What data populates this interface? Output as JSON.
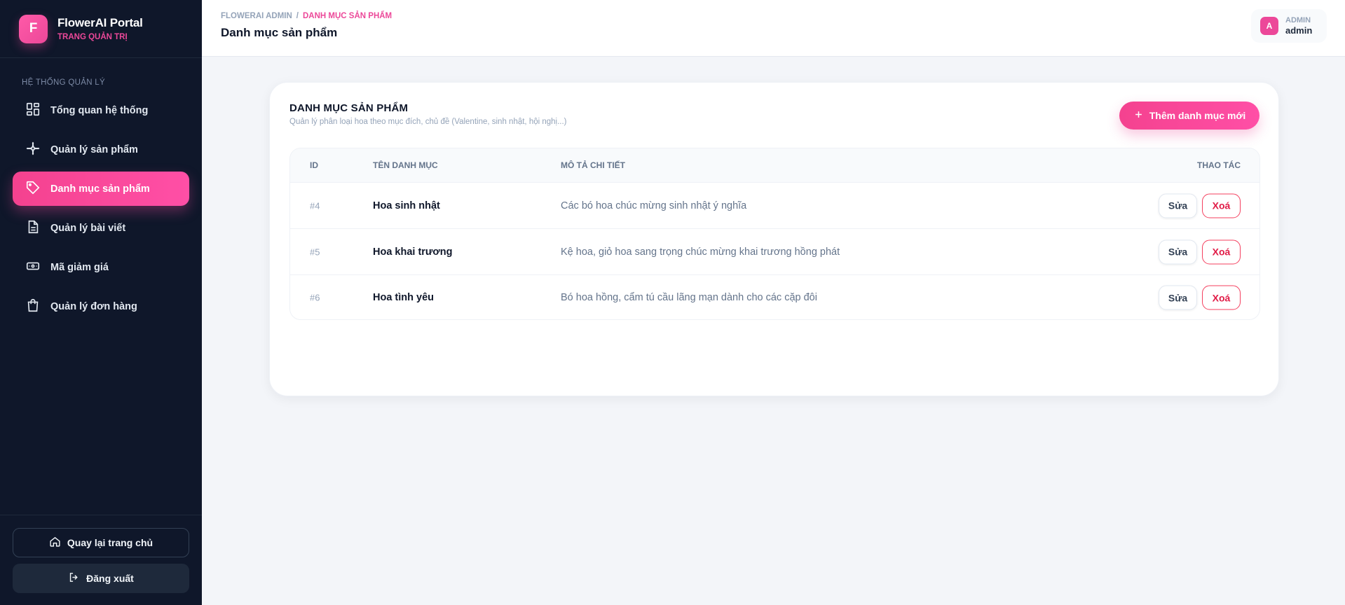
{
  "brand": {
    "logo_letter": "F",
    "title": "FlowerAI Portal",
    "subtitle": "TRANG QUẢN TRỊ"
  },
  "sidebar": {
    "heading": "HỆ THỐNG QUẢN LÝ",
    "items": [
      {
        "label": "Tổng quan hệ thống",
        "icon": "dashboard-grid-icon",
        "active": false
      },
      {
        "label": "Quản lý sản phẩm",
        "icon": "flower-icon",
        "active": false
      },
      {
        "label": "Danh mục sản phẩm",
        "icon": "tag-icon",
        "active": true
      },
      {
        "label": "Quản lý bài viết",
        "icon": "document-icon",
        "active": false
      },
      {
        "label": "Mã giảm giá",
        "icon": "ticket-icon",
        "active": false
      },
      {
        "label": "Quản lý đơn hàng",
        "icon": "shopping-bag-icon",
        "active": false
      }
    ],
    "home_label": "Quay lại trang chủ",
    "logout_label": "Đăng xuất"
  },
  "header": {
    "breadcrumb": [
      "FLOWERAI ADMIN",
      "DANH MỤC SẢN PHẨM"
    ],
    "separator": "/",
    "title": "Danh mục sản phẩm",
    "user": {
      "avatar_letter": "A",
      "role": "ADMIN",
      "name": "admin"
    }
  },
  "main": {
    "card_title": "DANH MỤC SẢN PHẨM",
    "card_subtitle": "Quản lý phân loại hoa theo mục đích, chủ đề (Valentine, sinh nhật, hội nghị...)",
    "add_button": "Thêm danh mục mới",
    "columns": [
      "ID",
      "TÊN DANH MỤC",
      "MÔ TẢ CHI TIẾT",
      "THAO TÁC"
    ],
    "rows": [
      {
        "id": "#4",
        "name": "Hoa sinh nhật",
        "description": "Các bó hoa chúc mừng sinh nhật ý nghĩa"
      },
      {
        "id": "#5",
        "name": "Hoa khai trương",
        "description": "Kệ hoa, giỏ hoa sang trọng chúc mừng khai trương hồng phát"
      },
      {
        "id": "#6",
        "name": "Hoa tình yêu",
        "description": "Bó hoa hồng, cẩm tú cầu lãng mạn dành cho các cặp đôi"
      }
    ],
    "edit_label": "Sửa",
    "delete_label": "Xoá"
  },
  "colors": {
    "accent": "#ec4899",
    "sidebar_bg": "#0f172a",
    "danger": "#e11d48"
  }
}
